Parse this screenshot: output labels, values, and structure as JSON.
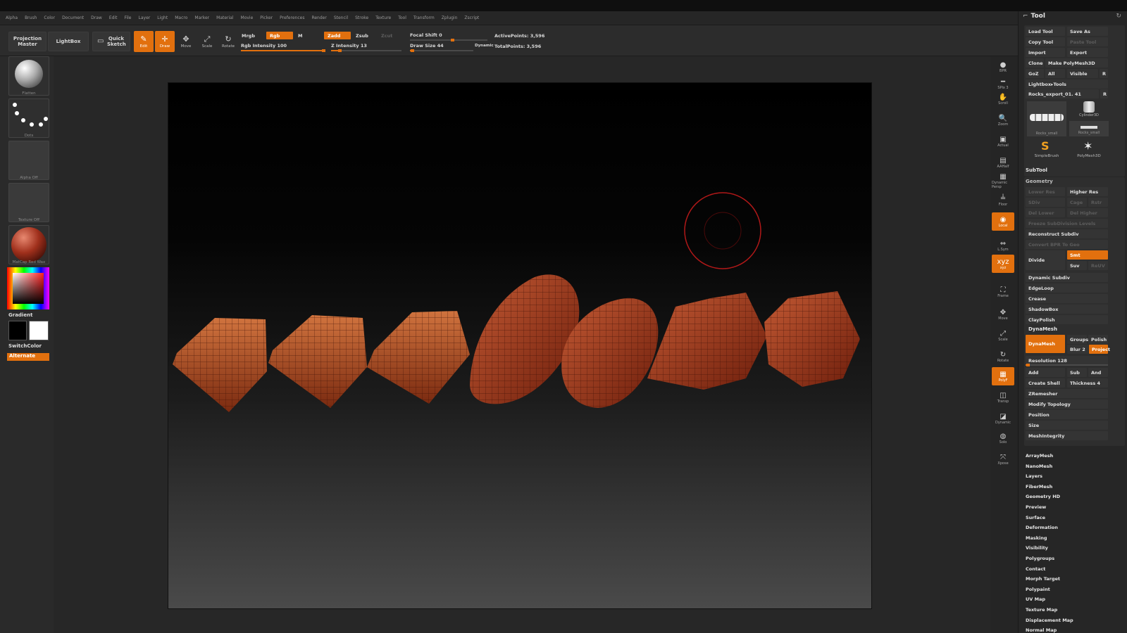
{
  "menu": [
    "Alpha",
    "Brush",
    "Color",
    "Document",
    "Draw",
    "Edit",
    "File",
    "Layer",
    "Light",
    "Macro",
    "Marker",
    "Material",
    "Movie",
    "Picker",
    "Preferences",
    "Render",
    "Stencil",
    "Stroke",
    "Texture",
    "Tool",
    "Transform",
    "Zplugin",
    "Zscript"
  ],
  "toolbar": {
    "projection_master": "Projection Master",
    "lightbox": "LightBox",
    "quick_sketch": "Quick Sketch",
    "edit": "Edit",
    "draw": "Draw",
    "move": "Move",
    "scale": "Scale",
    "rotate": "Rotate",
    "mrgb": "Mrgb",
    "rgb": "Rgb",
    "m": "M",
    "zadd": "Zadd",
    "zsub": "Zsub",
    "zcut": "Zcut",
    "rgb_intensity": "Rgb Intensity 100",
    "z_intensity": "Z Intensity 13",
    "focal_shift": "Focal Shift 0",
    "draw_size": "Draw Size 44",
    "dynamic": "Dynamic",
    "active_points": "ActivePoints: 3,596",
    "total_points": "TotalPoints: 3,596",
    "rgb_intensity_value": 100,
    "z_intensity_value": 13,
    "draw_size_value": 44
  },
  "left_shelf": {
    "brush_caption": "Flatten",
    "stroke_caption": "Dots",
    "alpha_caption": "Alpha Off",
    "texture_caption": "Texture Off",
    "material_caption": "MatCap Red Wax",
    "gradient": "Gradient",
    "switch_color": "SwitchColor",
    "alternate": "Alternate"
  },
  "right_shelf": [
    {
      "icon": "bpr-icon",
      "label": "BPR"
    },
    {
      "icon": "spix-icon",
      "label": "SPix 3"
    },
    {
      "icon": "scroll-icon",
      "label": "Scroll"
    },
    {
      "icon": "zoom-icon",
      "label": "Zoom"
    },
    {
      "icon": "actual-icon",
      "label": "Actual"
    },
    {
      "icon": "aahalf-icon",
      "label": "AAHalf"
    },
    {
      "icon": "persp-icon",
      "label": "Dynamic Persp"
    },
    {
      "icon": "floor-icon",
      "label": "Floor"
    },
    {
      "icon": "local-icon",
      "label": "Local"
    },
    {
      "icon": "lsym-icon",
      "label": "L.Sym"
    },
    {
      "icon": "xyz-icon",
      "label": "xyz"
    },
    {
      "icon": "frame-icon",
      "label": "Frame"
    },
    {
      "icon": "move-icon",
      "label": "Move"
    },
    {
      "icon": "scale-icon",
      "label": "Scale"
    },
    {
      "icon": "rotate-icon",
      "label": "Rotate"
    },
    {
      "icon": "polyf-icon",
      "label": "PolyF"
    },
    {
      "icon": "transp-icon",
      "label": "Transp"
    },
    {
      "icon": "ghost-icon",
      "label": "Dynamic"
    },
    {
      "icon": "solo-icon",
      "label": "Solo"
    },
    {
      "icon": "xpose-icon",
      "label": "Xpose"
    }
  ],
  "tool_panel": {
    "title": "Tool",
    "load_tool": "Load Tool",
    "save_as": "Save As",
    "copy_tool": "Copy Tool",
    "paste_tool": "Paste Tool",
    "import": "Import",
    "export": "Export",
    "clone": "Clone",
    "make_polymesh": "Make PolyMesh3D",
    "goz": "GoZ",
    "all": "All",
    "visible": "Visible",
    "r": "R",
    "lightbox_tools": "Lightbox▸Tools",
    "current_tool": "Rocks_export_01. 41",
    "thumb_rocks": "Rocks_small",
    "thumb_cylinder": "Cylinder3D",
    "thumb_rocks2": "Rocks_small",
    "thumb_simplebrush": "SimpleBrush",
    "thumb_polymesh": "PolyMesh3D",
    "subtool": "SubTool",
    "geometry": "Geometry",
    "lower_res": "Lower Res",
    "higher_res": "Higher Res",
    "sdiv": "SDiv",
    "cage": "Cage",
    "rstr": "Rstr",
    "del_lower": "Del Lower",
    "del_higher": "Del Higher",
    "freeze_subdiv": "Freeze SubDivision Levels",
    "reconstruct_subdiv": "Reconstruct Subdiv",
    "convert_bpr": "Convert BPR To Geo",
    "divide": "Divide",
    "smt": "Smt",
    "suv": "Suv",
    "reuv": "ReUV",
    "dynamic_subdiv": "Dynamic Subdiv",
    "edgeloop": "EdgeLoop",
    "crease": "Crease",
    "shadowbox": "ShadowBox",
    "claypolish": "ClayPolish",
    "dynamesh_header": "DynaMesh",
    "dynamesh_btn": "DynaMesh",
    "groups": "Groups",
    "polish": "Polish",
    "blur": "Blur 2",
    "project": "Project",
    "resolution": "Resolution 128",
    "resolution_value": 128,
    "add": "Add",
    "sub": "Sub",
    "and": "And",
    "create_shell": "Create Shell",
    "thickness": "Thickness 4",
    "zremesher": "ZRemesher",
    "modify_topology": "Modify Topology",
    "position": "Position",
    "size": "Size",
    "meshintegrity": "MeshIntegrity",
    "sections": [
      "ArrayMesh",
      "NanoMesh",
      "Layers",
      "FiberMesh",
      "Geometry HD",
      "Preview",
      "Surface",
      "Deformation",
      "Masking",
      "Visibility",
      "Polygroups",
      "Contact",
      "Morph Target",
      "Polypaint",
      "UV Map",
      "Texture Map",
      "Displacement Map",
      "Normal Map"
    ]
  },
  "colors": {
    "accent": "#e2700e",
    "bg": "#2b2b2b",
    "mesh": "#b0431f"
  }
}
